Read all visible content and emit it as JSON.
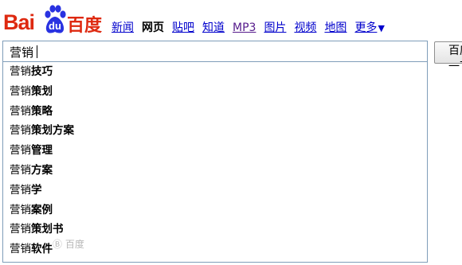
{
  "logo": {
    "latin": "Bai",
    "badge": "du",
    "chinese": "百度",
    "colors": {
      "red": "#de2910",
      "blue": "#2932e1"
    }
  },
  "nav": {
    "items": [
      {
        "label": "新闻"
      },
      {
        "label": "网页",
        "active": true
      },
      {
        "label": "贴吧"
      },
      {
        "label": "知道"
      },
      {
        "label": "MP3"
      },
      {
        "label": "图片"
      },
      {
        "label": "视频"
      },
      {
        "label": "地图"
      }
    ],
    "more_label": "更多",
    "more_icon": "triangle-down-icon"
  },
  "search": {
    "value": "营销",
    "button_label": "百度一下"
  },
  "suggestions": {
    "typed": "营销",
    "items": [
      "技巧",
      "策划",
      "策略",
      "策划方案",
      "管理",
      "方案",
      "学",
      "案例",
      "策划书",
      "软件"
    ]
  },
  "watermark": {
    "text": "Ⓑ 百度"
  }
}
